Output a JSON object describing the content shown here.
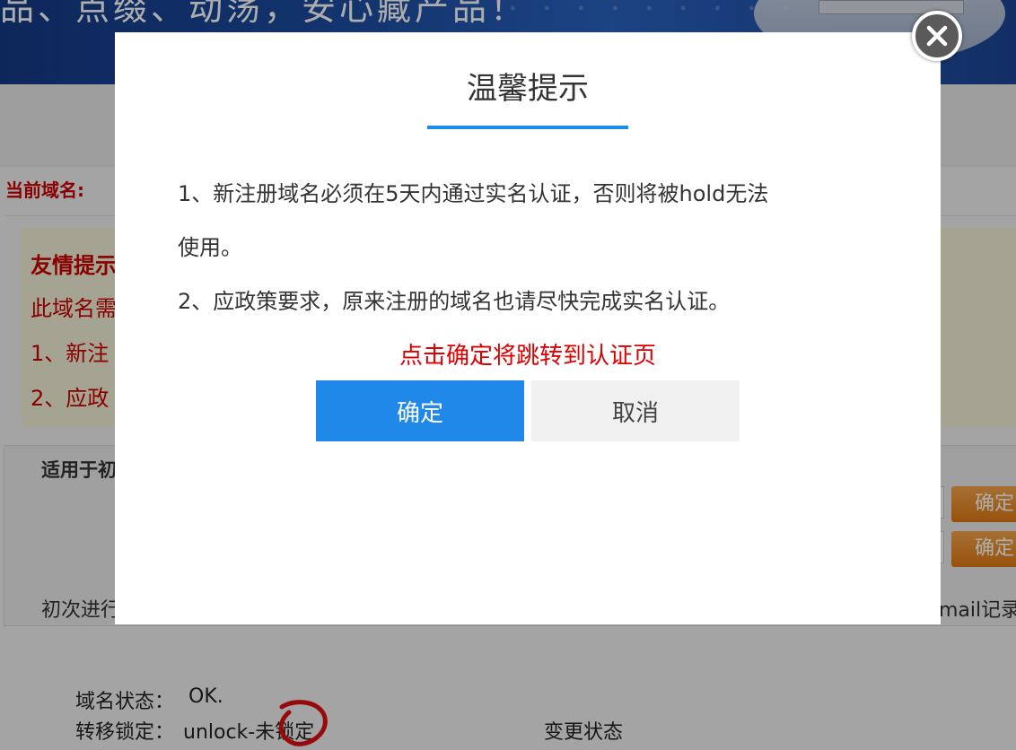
{
  "background": {
    "banner_text": "品、点缀、动荡，安心藏产品！",
    "current_domain_label": "当前域名:",
    "tip_title": "友情提示",
    "tip_lines": [
      "此域名需",
      "1、新注",
      "2、应政"
    ],
    "apply_title": "适用于初",
    "confirm_buttons": [
      "确定",
      "确定"
    ],
    "first_time_text": "初次进行",
    "mail_text": "mail记录",
    "domain_status_label": "域名状态：",
    "domain_status_value": "OK.",
    "transfer_lock_label": "转移锁定：",
    "transfer_lock_value": "unlock-未锁定",
    "change_status_link": "变更状态",
    "colors": {
      "banner": "#1d4ea3",
      "tip_red": "#cc0000",
      "orange": "#e07a12"
    }
  },
  "dialog": {
    "title": "温馨提示",
    "message_line1": "1、新注册域名必须在5天内通过实名认证，否则将被hold无法",
    "message_line1b": "使用。",
    "message_line2": "2、应政策要求，原来注册的域名也请尽快完成实名认证。",
    "redirect_note": "点击确定将跳转到认证页",
    "confirm_label": "确定",
    "cancel_label": "取消",
    "close_icon": "close-icon",
    "colors": {
      "accent": "#2088e8",
      "note_red": "#e10000"
    }
  }
}
